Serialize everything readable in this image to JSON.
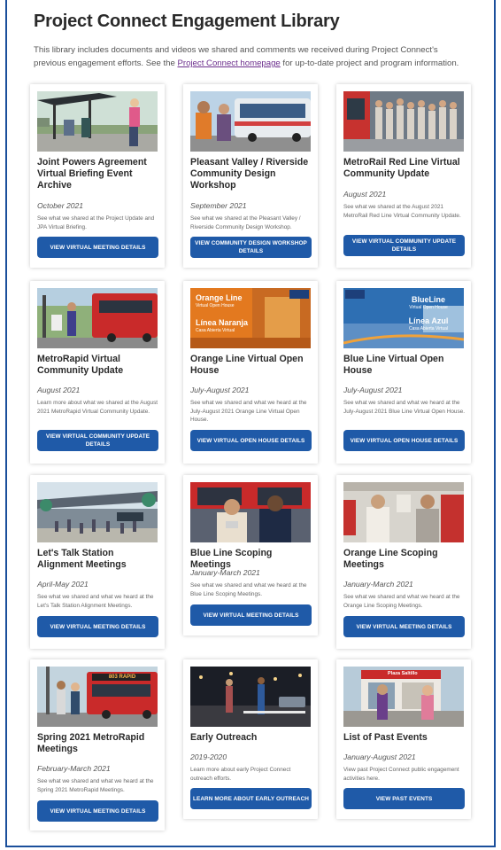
{
  "page": {
    "title": "Project Connect Engagement Library",
    "intro_before": "This library includes documents and videos we shared and comments we received during Project Connect's previous engagement efforts. See the ",
    "intro_link": "Project Connect homepage",
    "intro_after": " for up-to-date project and program information."
  },
  "cards": [
    {
      "title": "Joint Powers Agreement Virtual Briefing Event Archive",
      "date": "October 2021",
      "desc": "See what we shared at the Project Update and JPA Virtual Briefing.",
      "button": "VIEW VIRTUAL MEETING DETAILS",
      "image": "bus-stop-photo"
    },
    {
      "title": "Pleasant Valley / Riverside Community Design Workshop",
      "date": "September 2021",
      "desc": "See what we shared at the Pleasant Valley / Riverside Community Design Workshop.",
      "button": "VIEW COMMUNITY DESIGN WORKSHOP DETAILS",
      "image": "bus-riders-photo"
    },
    {
      "title": "MetroRail Red Line Virtual Community Update",
      "date": "August 2021",
      "desc": "See what we shared at the August 2021 MetroRail Red Line Virtual Community Update.",
      "button": "VIEW VIRTUAL COMMUNITY UPDATE DETAILS",
      "image": "rail-platform-photo"
    },
    {
      "title": "MetroRapid Virtual Community Update",
      "date": "August 2021",
      "desc": "Learn more about what we shared at the August 2021 MetroRapid Virtual Community Update.",
      "button": "VIEW VIRTUAL COMMUNITY UPDATE DETAILS",
      "image": "metrorapid-bus-photo"
    },
    {
      "title": "Orange Line Virtual Open House",
      "date": "July-August 2021",
      "desc": "See what we shared and what we heard at the July-August 2021 Orange Line Virtual Open House.",
      "button": "VIEW VIRTUAL OPEN HOUSE DETAILS",
      "image": "orange-line-graphic",
      "img_line1": "Orange Line",
      "img_sub1": "Virtual Open House",
      "img_line2": "Línea Naranja",
      "img_sub2": "Casa Abierta Virtual"
    },
    {
      "title": "Blue Line Virtual Open House",
      "date": "July-August 2021",
      "desc": "See what we shared and what we heard at the July-August 2021 Blue Line Virtual Open House.",
      "button": "VIEW VIRTUAL OPEN HOUSE DETAILS",
      "image": "blue-line-graphic",
      "img_line1": "BlueLine",
      "img_sub1": "Virtual Open House",
      "img_line2": "Línea Azul",
      "img_sub2": "Casa Abierta Virtual"
    },
    {
      "title": "Let's Talk Station Alignment Meetings",
      "date": "April-May 2021",
      "desc": "See what we shared and what we heard at the Let's Talk Station Alignment Meetings.",
      "button": "VIEW VIRTUAL MEETING DETAILS",
      "image": "station-rendering"
    },
    {
      "title": "Blue Line Scoping Meetings",
      "date": "January-March 2021",
      "desc": "See what we shared and what we heard at the Blue Line Scoping Meetings.",
      "button": "VIEW VIRTUAL MEETING DETAILS",
      "image": "bus-operators-photo"
    },
    {
      "title": "Orange Line Scoping Meetings",
      "date": "January-March 2021",
      "desc": "See what we shared and what we heard at the Orange Line Scoping Meetings.",
      "button": "VIEW VIRTUAL MEETING DETAILS",
      "image": "train-interior-photo"
    },
    {
      "title": "Spring 2021 MetroRapid Meetings",
      "date": "February-March 2021",
      "desc": "See what we shared and what we heard at the Spring 2021 MetroRapid Meetings.",
      "button": "VIEW VIRTUAL MEETING DETAILS",
      "image": "metrorapid-803-photo",
      "img_sign": "803 RAPID"
    },
    {
      "title": "Early Outreach",
      "date": "2019-2020",
      "desc": "Learn more about early Project Connect outreach efforts.",
      "button": "LEARN MORE ABOUT EARLY OUTREACH",
      "image": "night-street-photo"
    },
    {
      "title": "List of Past Events",
      "date": "January-August 2021",
      "desc": "View past Project Connect public engagement activities here.",
      "button": "VIEW PAST EVENTS",
      "image": "plaza-saltillo-photo",
      "img_sign": "Plaza Saltillo"
    }
  ],
  "colors": {
    "button": "#1f5aa8",
    "frame": "#1b4f9b",
    "link": "#6b2d8c"
  }
}
